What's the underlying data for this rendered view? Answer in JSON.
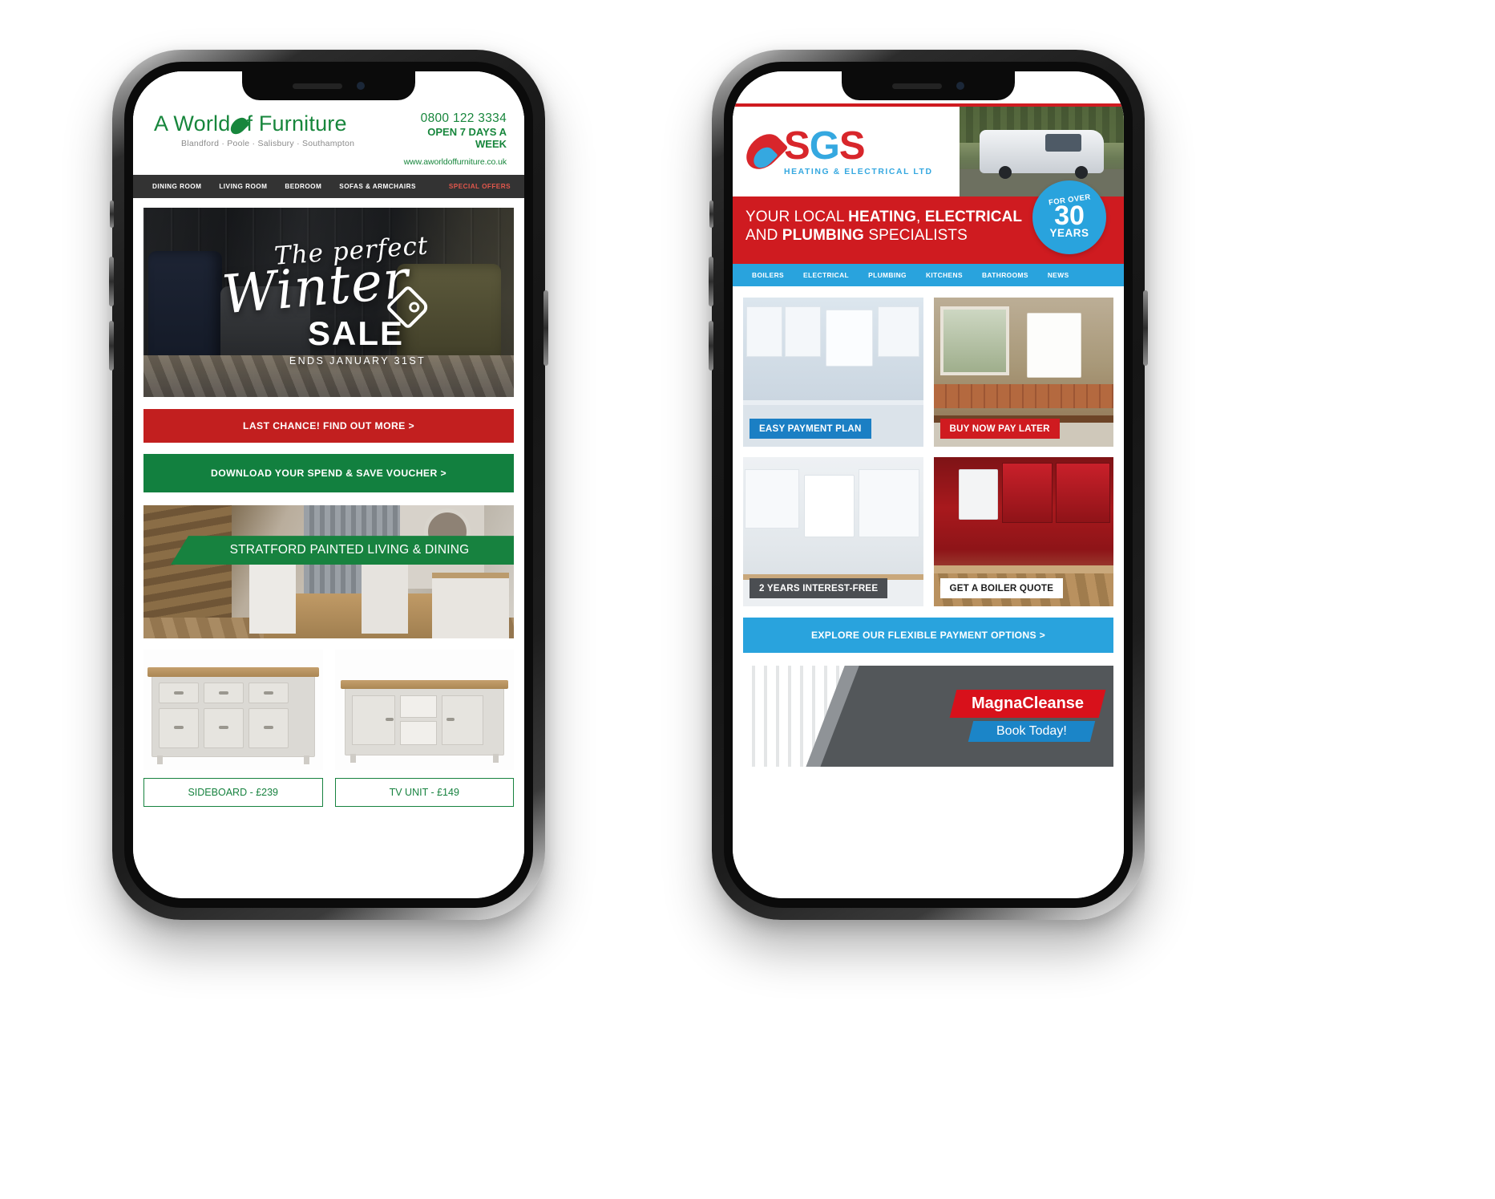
{
  "left_phone": {
    "device": "smartphone-mockup",
    "site": {
      "brand": {
        "name_part1": "A World",
        "name_part2": "f Furniture",
        "leaf_icon": "leaf-icon",
        "towns": "Blandford · Poole · Salisbury · Southampton"
      },
      "contact": {
        "phone": "0800 122 3334",
        "hours": "OPEN 7 DAYS A WEEK",
        "website": "www.aworldoffurniture.co.uk"
      },
      "nav": [
        {
          "label": "DINING ROOM",
          "highlight": false
        },
        {
          "label": "LIVING ROOM",
          "highlight": false
        },
        {
          "label": "BEDROOM",
          "highlight": false
        },
        {
          "label": "SOFAS & ARMCHAIRS",
          "highlight": false
        },
        {
          "label": "SPECIAL OFFERS",
          "highlight": true
        }
      ],
      "hero": {
        "line1": "The perfect",
        "line2": "Winter",
        "line3": "SALE",
        "line4": "ENDS JANUARY 31ST",
        "tag_icon": "price-tag-icon"
      },
      "cta_primary": "LAST CHANCE! FIND OUT MORE >",
      "cta_secondary": "DOWNLOAD YOUR SPEND & SAVE VOUCHER >",
      "range_banner": "STRATFORD PAINTED LIVING & DINING",
      "products": [
        {
          "label": "SIDEBOARD - £239"
        },
        {
          "label": "TV UNIT - £149"
        }
      ],
      "colors": {
        "brand_green": "#17863c",
        "cta_red": "#c21f1f",
        "cta_green": "#12803f",
        "nav_bar": "#333333",
        "special_offers": "#e2574c"
      }
    }
  },
  "right_phone": {
    "device": "smartphone-mockup",
    "site": {
      "brand": {
        "letters": "SGS",
        "tagline": "HEATING & ELECTRICAL LTD",
        "flame_icon": "flame-icon",
        "van_image": "service-van-photo"
      },
      "band": {
        "line1_plain_a": "YOUR LOCAL ",
        "line1_bold_a": "HEATING",
        "line1_plain_b": ", ",
        "line1_bold_b": "ELECTRICAL",
        "line2_plain_a": "AND ",
        "line2_bold_a": "PLUMBING",
        "line2_plain_b": " SPECIALISTS",
        "badge_for": "FOR OVER",
        "badge_number": "30",
        "badge_years": "YEARS"
      },
      "nav": [
        {
          "label": "BOILERS"
        },
        {
          "label": "ELECTRICAL"
        },
        {
          "label": "PLUMBING"
        },
        {
          "label": "KITCHENS"
        },
        {
          "label": "BATHROOMS"
        },
        {
          "label": "NEWS"
        }
      ],
      "tiles": [
        {
          "label": "EASY PAYMENT PLAN",
          "style": "blue"
        },
        {
          "label": "BUY NOW PAY LATER",
          "style": "red"
        },
        {
          "label": "2 YEARS INTEREST-FREE",
          "style": "dark"
        },
        {
          "label": "GET A BOILER QUOTE",
          "style": "white"
        }
      ],
      "cta": "EXPLORE OUR FLEXIBLE PAYMENT OPTIONS >",
      "promo": {
        "name": "MagnaCleanse",
        "action": "Book Today!"
      },
      "colors": {
        "red": "#cf1b20",
        "blue": "#29a3dd",
        "dark": "#4b4e52"
      }
    }
  }
}
